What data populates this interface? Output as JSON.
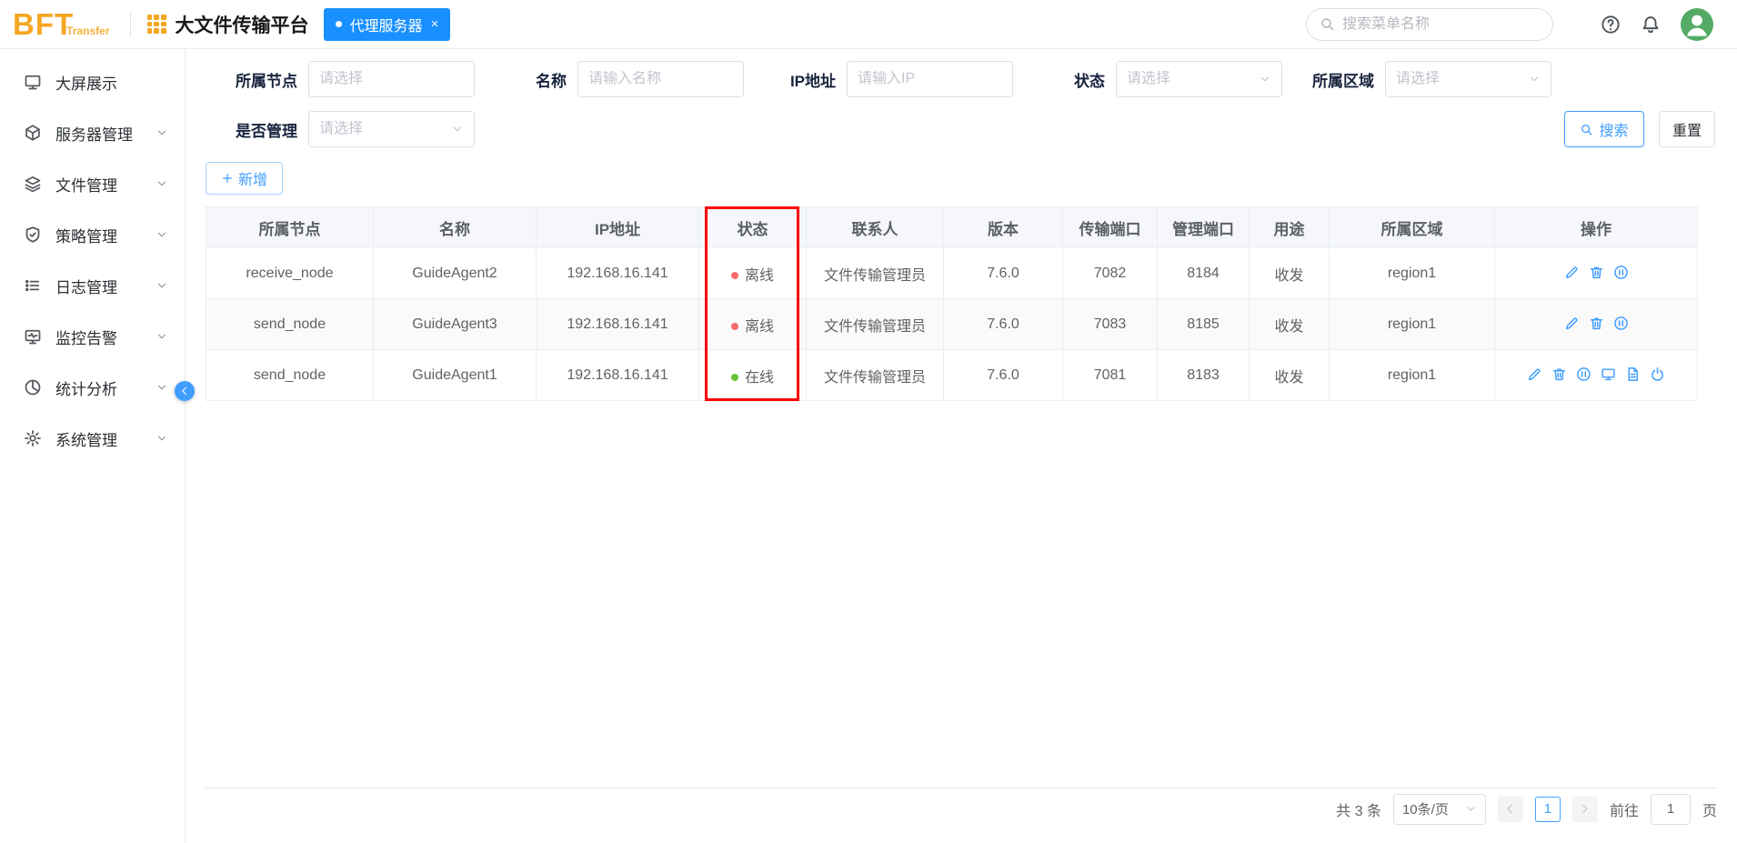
{
  "colors": {
    "accent_blue": "#409eff",
    "tab_blue": "#1890ff",
    "brand_orange": "#f5a623",
    "status_offline": "#f56c6c",
    "status_online": "#67c23a",
    "annotation_red": "#ff0000"
  },
  "header": {
    "logo_main": "BFT",
    "logo_sub": "Transfer",
    "app_title": "大文件传输平台",
    "tab": {
      "label": "代理服务器",
      "close_label": "×"
    },
    "search_placeholder": "搜索菜单名称"
  },
  "sidebar": {
    "items": [
      {
        "label": "大屏展示",
        "icon": "screen-icon",
        "expandable": false
      },
      {
        "label": "服务器管理",
        "icon": "server-icon",
        "expandable": true
      },
      {
        "label": "文件管理",
        "icon": "files-icon",
        "expandable": true
      },
      {
        "label": "策略管理",
        "icon": "policy-icon",
        "expandable": true
      },
      {
        "label": "日志管理",
        "icon": "log-icon",
        "expandable": true
      },
      {
        "label": "监控告警",
        "icon": "alert-icon",
        "expandable": true
      },
      {
        "label": "统计分析",
        "icon": "stats-icon",
        "expandable": true
      },
      {
        "label": "系统管理",
        "icon": "settings-icon",
        "expandable": true
      }
    ]
  },
  "filters": {
    "fields": [
      {
        "label": "所属节点",
        "placeholder": "请选择",
        "control": "select",
        "arrow": false,
        "row": 1
      },
      {
        "label": "名称",
        "placeholder": "请输入名称",
        "control": "input",
        "arrow": false,
        "row": 1
      },
      {
        "label": "IP地址",
        "placeholder": "请输入IP",
        "control": "input",
        "arrow": false,
        "row": 1
      },
      {
        "label": "状态",
        "placeholder": "请选择",
        "control": "select",
        "arrow": true,
        "row": 1
      },
      {
        "label": "所属区域",
        "placeholder": "请选择",
        "control": "select",
        "arrow": true,
        "row": 1
      },
      {
        "label": "是否管理",
        "placeholder": "请选择",
        "control": "select",
        "arrow": true,
        "row": 2
      }
    ],
    "search_button": "搜索",
    "reset_button": "重置"
  },
  "toolbar": {
    "add_button": "新增"
  },
  "table": {
    "columns": [
      "所属节点",
      "名称",
      "IP地址",
      "状态",
      "联系人",
      "版本",
      "传输端口",
      "管理端口",
      "用途",
      "所属区域",
      "操作"
    ],
    "rows": [
      {
        "node": "receive_node",
        "name": "GuideAgent2",
        "ip": "192.168.16.141",
        "status": "离线",
        "online": false,
        "contact": "文件传输管理员",
        "version": "7.6.0",
        "transfer_port": "7082",
        "manage_port": "8184",
        "usage": "收发",
        "region": "region1",
        "actions": [
          "edit-icon",
          "delete-icon",
          "pause-icon"
        ]
      },
      {
        "node": "send_node",
        "name": "GuideAgent3",
        "ip": "192.168.16.141",
        "status": "离线",
        "online": false,
        "contact": "文件传输管理员",
        "version": "7.6.0",
        "transfer_port": "7083",
        "manage_port": "8185",
        "usage": "收发",
        "region": "region1",
        "actions": [
          "edit-icon",
          "delete-icon",
          "pause-icon"
        ]
      },
      {
        "node": "send_node",
        "name": "GuideAgent1",
        "ip": "192.168.16.141",
        "status": "在线",
        "online": true,
        "contact": "文件传输管理员",
        "version": "7.6.0",
        "transfer_port": "7081",
        "manage_port": "8183",
        "usage": "收发",
        "region": "region1",
        "actions": [
          "edit-icon",
          "delete-icon",
          "pause-icon",
          "monitor-icon",
          "doc-icon",
          "power-icon"
        ]
      }
    ]
  },
  "annotation": {
    "type": "red-highlight-box",
    "target_column": "状态"
  },
  "pagination": {
    "total_text": "共 3 条",
    "page_size": "10条/页",
    "current_page": "1",
    "goto_label": "前往",
    "goto_value": "1",
    "unit_label": "页"
  }
}
